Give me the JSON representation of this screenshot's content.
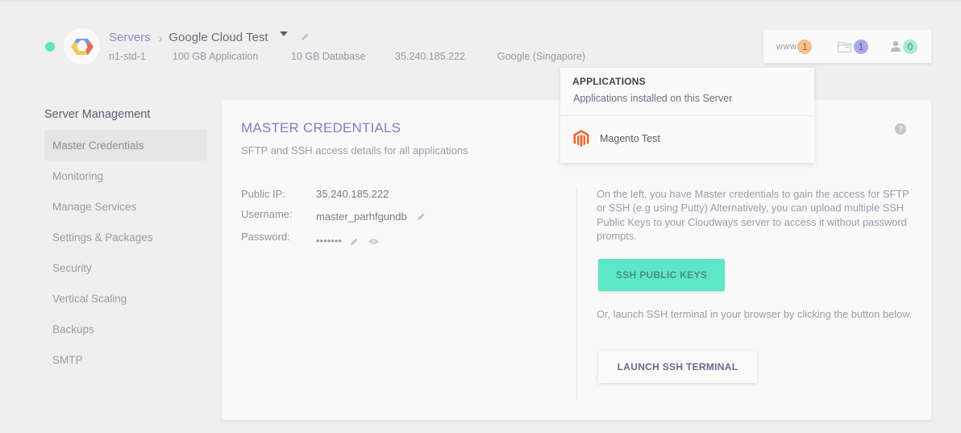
{
  "header": {
    "status": "online",
    "status_color": "#5ee4c2",
    "breadcrumb": {
      "root": "Servers",
      "separator": ">",
      "server_name": "Google Cloud Test"
    },
    "meta": {
      "size": "n1-std-1",
      "app_storage": "100 GB Application",
      "db_storage": "10 GB Database",
      "ip": "35.240.185.222",
      "provider": "Google (Singapore)"
    },
    "counters": {
      "www_label": "www",
      "applications": "1",
      "databases": "1",
      "users": "0"
    }
  },
  "apps_dropdown": {
    "title": "APPLICATIONS",
    "subtitle": "Applications installed on this Server",
    "items": [
      {
        "name": "Magento Test",
        "icon": "magento-icon"
      }
    ]
  },
  "sidebar": {
    "heading": "Server Management",
    "items": [
      {
        "label": "Master Credentials",
        "active": true
      },
      {
        "label": "Monitoring"
      },
      {
        "label": "Manage Services"
      },
      {
        "label": "Settings & Packages"
      },
      {
        "label": "Security"
      },
      {
        "label": "Vertical Scaling"
      },
      {
        "label": "Backups"
      },
      {
        "label": "SMTP"
      }
    ]
  },
  "main": {
    "title": "MASTER CREDENTIALS",
    "subtitle": "SFTP and SSH access details for all applications",
    "help": "?",
    "credentials": {
      "ip_label": "Public IP:",
      "ip_value": "35.240.185.222",
      "username_label": "Username:",
      "username_value": "master_parhfgundb",
      "password_label": "Password:",
      "password_value": "•••••••"
    },
    "info_text": "On the left, you have Master credentials to gain the access for SFTP or SSH (e.g using Putty) Alternatively, you can upload multiple SSH Public Keys to your Cloudways server to access it without password prompts.",
    "ssh_keys_button": "SSH PUBLIC KEYS",
    "terminal_text": "Or, launch SSH terminal in your browser by clicking the button below.",
    "terminal_button": "LAUNCH SSH TERMINAL"
  },
  "colors": {
    "accent": "#7b7fc6",
    "primary_button": "#5ee7c6",
    "badge_www": "#f6c08b",
    "badge_db": "#aaaae6",
    "badge_users": "#a6ebd6"
  }
}
